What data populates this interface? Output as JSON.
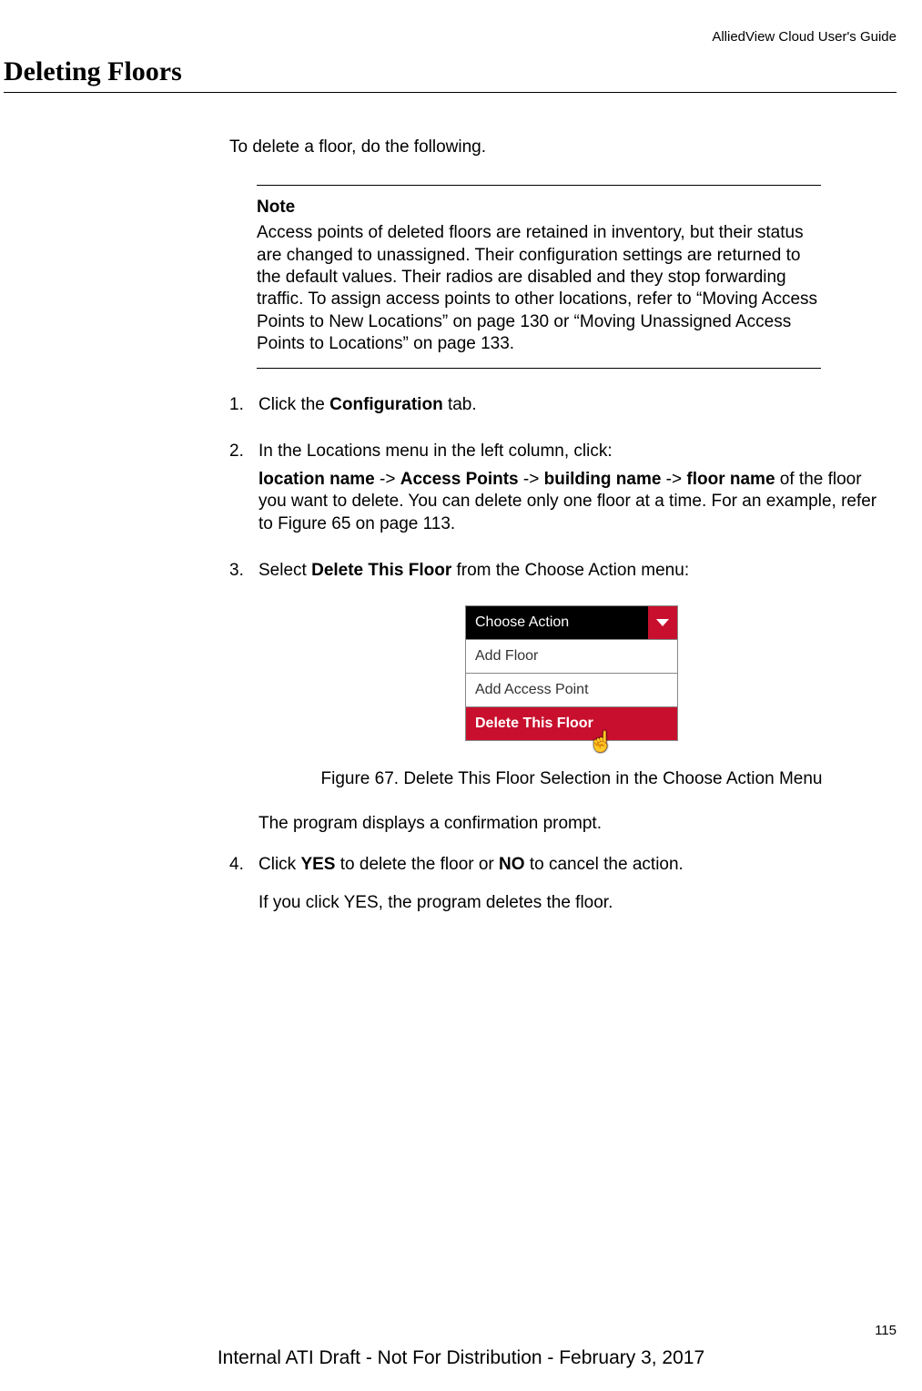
{
  "header": {
    "doc_title": "AlliedView Cloud User's Guide"
  },
  "section": {
    "title": "Deleting Floors",
    "intro": "To delete a floor, do the following."
  },
  "note": {
    "label": "Note",
    "body": "Access points of deleted floors are retained in inventory, but their status are changed to unassigned. Their configuration settings are returned to the default values. Their radios are disabled and they stop forwarding traffic. To assign access points to other locations, refer to “Moving Access Points to New Locations” on page 130 or “Moving Unassigned Access Points to Locations” on page 133."
  },
  "steps": {
    "s1": {
      "num": "1.",
      "pre": "Click the ",
      "bold": "Configuration",
      "post": " tab."
    },
    "s2": {
      "num": "2.",
      "line1_pre": "In the Locations menu in the left column, click:",
      "path_loc": "location name",
      "arrow": " -> ",
      "path_ap": "Access Points",
      "path_bldg": "building name",
      "path_floor": "floor name",
      "line2_post": "of the floor you want to delete. You can delete only one floor at a time. For an example, refer to Figure 65 on page 113."
    },
    "s3": {
      "num": "3.",
      "pre": "Select ",
      "bold": "Delete This Floor",
      "post": " from the Choose Action menu:"
    },
    "s4": {
      "num": "4.",
      "pre": "Click ",
      "yes": "YES",
      "mid": " to delete the floor or ",
      "no": "NO",
      "post": " to cancel the action.",
      "after": "If you click YES, the program deletes the floor."
    }
  },
  "dropdown": {
    "header": "Choose Action",
    "opt1": "Add Floor",
    "opt2": "Add Access Point",
    "opt3": "Delete This Floor"
  },
  "figure": {
    "caption": "Figure 67. Delete This Floor Selection in the Choose Action Menu",
    "after_text": "The program displays a confirmation prompt."
  },
  "footer": {
    "page_number": "115",
    "watermark": "Internal ATI Draft - Not For Distribution - February 3, 2017"
  }
}
